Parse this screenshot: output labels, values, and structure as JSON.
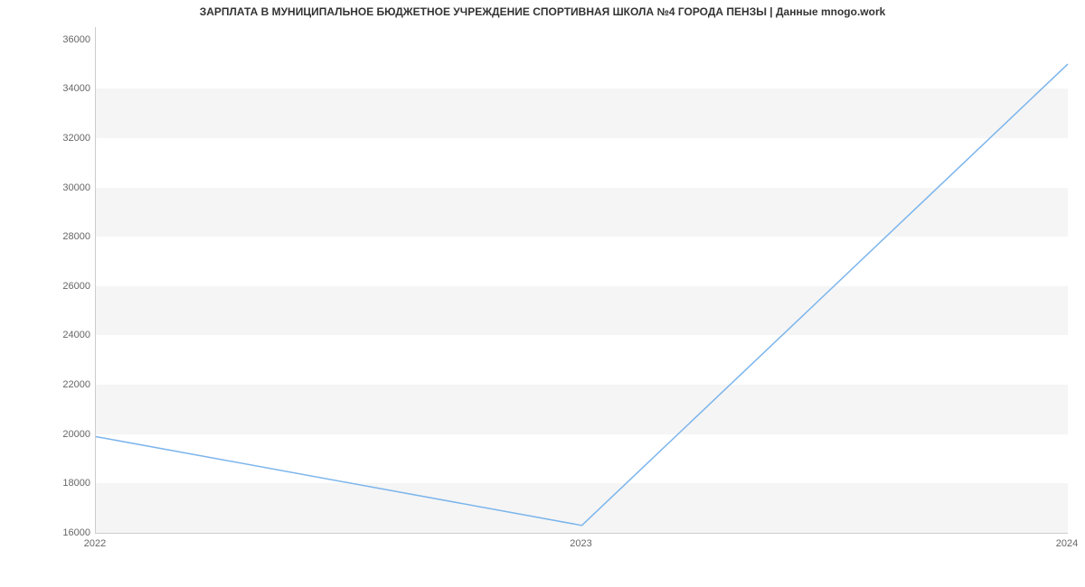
{
  "chart_data": {
    "type": "line",
    "title": "ЗАРПЛАТА В МУНИЦИПАЛЬНОЕ БЮДЖЕТНОЕ УЧРЕЖДЕНИЕ СПОРТИВНАЯ ШКОЛА №4 ГОРОДА ПЕНЗЫ | Данные mnogo.work",
    "xlabel": "",
    "ylabel": "",
    "x": [
      2022,
      2023,
      2024
    ],
    "values": [
      19900,
      16300,
      35000
    ],
    "x_ticks": [
      2022,
      2023,
      2024
    ],
    "y_ticks": [
      16000,
      18000,
      20000,
      22000,
      24000,
      26000,
      28000,
      30000,
      32000,
      34000,
      36000
    ],
    "xlim": [
      2022,
      2024
    ],
    "ylim": [
      16000,
      36500
    ],
    "line_color": "#7cb5ec"
  }
}
